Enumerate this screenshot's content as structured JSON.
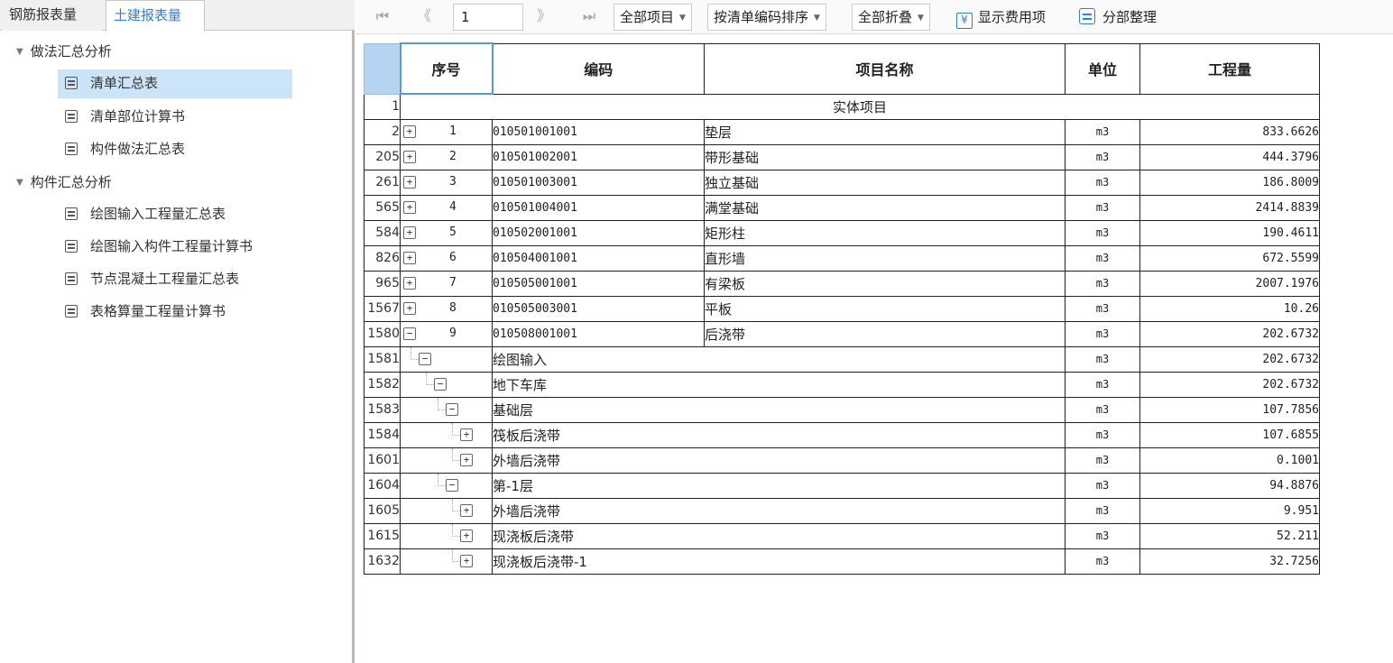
{
  "tabs": {
    "rebar": "钢筋报表量",
    "civil": "土建报表量"
  },
  "tree": {
    "group1": "做法汇总分析",
    "group1_items": [
      "清单汇总表",
      "清单部位计算书",
      "构件做法汇总表"
    ],
    "group2": "构件汇总分析",
    "group2_items": [
      "绘图输入工程量汇总表",
      "绘图输入构件工程量计算书",
      "节点混凝土工程量汇总表",
      "表格算量工程量计算书"
    ]
  },
  "toolbar": {
    "first_icon": "⏮",
    "prev_icon": "《",
    "page_value": "1",
    "next_icon": "》",
    "last_icon": "⏭",
    "filter_label": "全部项目",
    "sort_label": "按清单编码排序",
    "fold_label": "全部折叠",
    "show_fee_label": "显示费用项",
    "section_sort_label": "分部整理"
  },
  "table": {
    "headers": {
      "seq": "序号",
      "code": "编码",
      "name": "项目名称",
      "unit": "单位",
      "qty": "工程量"
    },
    "section_row": {
      "rownum": "1",
      "label": "实体项目"
    },
    "rows": [
      {
        "rownum": "2",
        "seq": "1",
        "code": "010501001001",
        "name": "垫层",
        "unit": "m3",
        "qty": "833.6626",
        "toggle": "+"
      },
      {
        "rownum": "205",
        "seq": "2",
        "code": "010501002001",
        "name": "带形基础",
        "unit": "m3",
        "qty": "444.3796",
        "toggle": "+"
      },
      {
        "rownum": "261",
        "seq": "3",
        "code": "010501003001",
        "name": "独立基础",
        "unit": "m3",
        "qty": "186.8009",
        "toggle": "+"
      },
      {
        "rownum": "565",
        "seq": "4",
        "code": "010501004001",
        "name": "满堂基础",
        "unit": "m3",
        "qty": "2414.8839",
        "toggle": "+"
      },
      {
        "rownum": "584",
        "seq": "5",
        "code": "010502001001",
        "name": "矩形柱",
        "unit": "m3",
        "qty": "190.4611",
        "toggle": "+"
      },
      {
        "rownum": "826",
        "seq": "6",
        "code": "010504001001",
        "name": "直形墙",
        "unit": "m3",
        "qty": "672.5599",
        "toggle": "+"
      },
      {
        "rownum": "965",
        "seq": "7",
        "code": "010505001001",
        "name": "有梁板",
        "unit": "m3",
        "qty": "2007.1976",
        "toggle": "+"
      },
      {
        "rownum": "1567",
        "seq": "8",
        "code": "010505003001",
        "name": "平板",
        "unit": "m3",
        "qty": "10.26",
        "toggle": "+"
      },
      {
        "rownum": "1580",
        "seq": "9",
        "code": "010508001001",
        "name": "后浇带",
        "unit": "m3",
        "qty": "202.6732",
        "toggle": "−"
      }
    ],
    "nested_rows": [
      {
        "rownum": "1581",
        "name": "绘图输入",
        "unit": "m3",
        "qty": "202.6732",
        "toggle": "−",
        "level": 1
      },
      {
        "rownum": "1582",
        "name": "地下车库",
        "unit": "m3",
        "qty": "202.6732",
        "toggle": "−",
        "level": 2
      },
      {
        "rownum": "1583",
        "name": "基础层",
        "unit": "m3",
        "qty": "107.7856",
        "toggle": "−",
        "level": 3
      },
      {
        "rownum": "1584",
        "name": "筏板后浇带",
        "unit": "m3",
        "qty": "107.6855",
        "toggle": "+",
        "level": 4
      },
      {
        "rownum": "1601",
        "name": "外墙后浇带",
        "unit": "m3",
        "qty": "0.1001",
        "toggle": "+",
        "level": 4
      },
      {
        "rownum": "1604",
        "name": "第-1层",
        "unit": "m3",
        "qty": "94.8876",
        "toggle": "−",
        "level": 3
      },
      {
        "rownum": "1605",
        "name": "外墙后浇带",
        "unit": "m3",
        "qty": "9.951",
        "toggle": "+",
        "level": 4
      },
      {
        "rownum": "1615",
        "name": "现浇板后浇带",
        "unit": "m3",
        "qty": "52.211",
        "toggle": "+",
        "level": 4
      },
      {
        "rownum": "1632",
        "name": "现浇板后浇带-1",
        "unit": "m3",
        "qty": "32.7256",
        "toggle": "+",
        "level": 4
      }
    ]
  },
  "colors": {
    "accent": "#2f7fd8",
    "selected_row": "#cce4f7",
    "header_corner": "#b5d4f2"
  }
}
